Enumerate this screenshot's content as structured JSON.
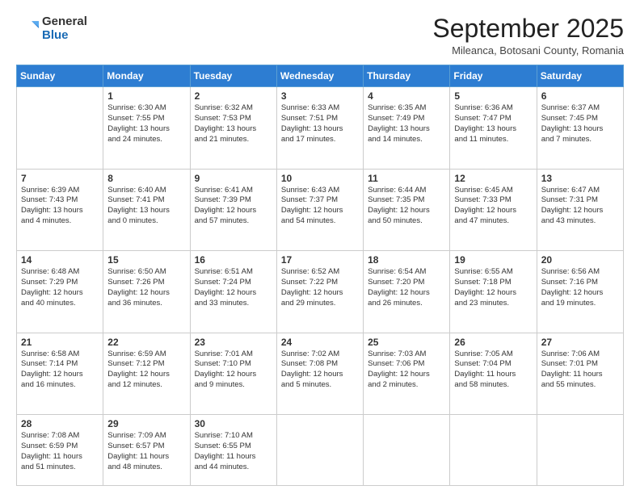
{
  "logo": {
    "general": "General",
    "blue": "Blue"
  },
  "title": "September 2025",
  "location": "Mileanca, Botosani County, Romania",
  "days_of_week": [
    "Sunday",
    "Monday",
    "Tuesday",
    "Wednesday",
    "Thursday",
    "Friday",
    "Saturday"
  ],
  "weeks": [
    [
      {
        "day": "",
        "info": ""
      },
      {
        "day": "1",
        "info": "Sunrise: 6:30 AM\nSunset: 7:55 PM\nDaylight: 13 hours\nand 24 minutes."
      },
      {
        "day": "2",
        "info": "Sunrise: 6:32 AM\nSunset: 7:53 PM\nDaylight: 13 hours\nand 21 minutes."
      },
      {
        "day": "3",
        "info": "Sunrise: 6:33 AM\nSunset: 7:51 PM\nDaylight: 13 hours\nand 17 minutes."
      },
      {
        "day": "4",
        "info": "Sunrise: 6:35 AM\nSunset: 7:49 PM\nDaylight: 13 hours\nand 14 minutes."
      },
      {
        "day": "5",
        "info": "Sunrise: 6:36 AM\nSunset: 7:47 PM\nDaylight: 13 hours\nand 11 minutes."
      },
      {
        "day": "6",
        "info": "Sunrise: 6:37 AM\nSunset: 7:45 PM\nDaylight: 13 hours\nand 7 minutes."
      }
    ],
    [
      {
        "day": "7",
        "info": "Sunrise: 6:39 AM\nSunset: 7:43 PM\nDaylight: 13 hours\nand 4 minutes."
      },
      {
        "day": "8",
        "info": "Sunrise: 6:40 AM\nSunset: 7:41 PM\nDaylight: 13 hours\nand 0 minutes."
      },
      {
        "day": "9",
        "info": "Sunrise: 6:41 AM\nSunset: 7:39 PM\nDaylight: 12 hours\nand 57 minutes."
      },
      {
        "day": "10",
        "info": "Sunrise: 6:43 AM\nSunset: 7:37 PM\nDaylight: 12 hours\nand 54 minutes."
      },
      {
        "day": "11",
        "info": "Sunrise: 6:44 AM\nSunset: 7:35 PM\nDaylight: 12 hours\nand 50 minutes."
      },
      {
        "day": "12",
        "info": "Sunrise: 6:45 AM\nSunset: 7:33 PM\nDaylight: 12 hours\nand 47 minutes."
      },
      {
        "day": "13",
        "info": "Sunrise: 6:47 AM\nSunset: 7:31 PM\nDaylight: 12 hours\nand 43 minutes."
      }
    ],
    [
      {
        "day": "14",
        "info": "Sunrise: 6:48 AM\nSunset: 7:29 PM\nDaylight: 12 hours\nand 40 minutes."
      },
      {
        "day": "15",
        "info": "Sunrise: 6:50 AM\nSunset: 7:26 PM\nDaylight: 12 hours\nand 36 minutes."
      },
      {
        "day": "16",
        "info": "Sunrise: 6:51 AM\nSunset: 7:24 PM\nDaylight: 12 hours\nand 33 minutes."
      },
      {
        "day": "17",
        "info": "Sunrise: 6:52 AM\nSunset: 7:22 PM\nDaylight: 12 hours\nand 29 minutes."
      },
      {
        "day": "18",
        "info": "Sunrise: 6:54 AM\nSunset: 7:20 PM\nDaylight: 12 hours\nand 26 minutes."
      },
      {
        "day": "19",
        "info": "Sunrise: 6:55 AM\nSunset: 7:18 PM\nDaylight: 12 hours\nand 23 minutes."
      },
      {
        "day": "20",
        "info": "Sunrise: 6:56 AM\nSunset: 7:16 PM\nDaylight: 12 hours\nand 19 minutes."
      }
    ],
    [
      {
        "day": "21",
        "info": "Sunrise: 6:58 AM\nSunset: 7:14 PM\nDaylight: 12 hours\nand 16 minutes."
      },
      {
        "day": "22",
        "info": "Sunrise: 6:59 AM\nSunset: 7:12 PM\nDaylight: 12 hours\nand 12 minutes."
      },
      {
        "day": "23",
        "info": "Sunrise: 7:01 AM\nSunset: 7:10 PM\nDaylight: 12 hours\nand 9 minutes."
      },
      {
        "day": "24",
        "info": "Sunrise: 7:02 AM\nSunset: 7:08 PM\nDaylight: 12 hours\nand 5 minutes."
      },
      {
        "day": "25",
        "info": "Sunrise: 7:03 AM\nSunset: 7:06 PM\nDaylight: 12 hours\nand 2 minutes."
      },
      {
        "day": "26",
        "info": "Sunrise: 7:05 AM\nSunset: 7:04 PM\nDaylight: 11 hours\nand 58 minutes."
      },
      {
        "day": "27",
        "info": "Sunrise: 7:06 AM\nSunset: 7:01 PM\nDaylight: 11 hours\nand 55 minutes."
      }
    ],
    [
      {
        "day": "28",
        "info": "Sunrise: 7:08 AM\nSunset: 6:59 PM\nDaylight: 11 hours\nand 51 minutes."
      },
      {
        "day": "29",
        "info": "Sunrise: 7:09 AM\nSunset: 6:57 PM\nDaylight: 11 hours\nand 48 minutes."
      },
      {
        "day": "30",
        "info": "Sunrise: 7:10 AM\nSunset: 6:55 PM\nDaylight: 11 hours\nand 44 minutes."
      },
      {
        "day": "",
        "info": ""
      },
      {
        "day": "",
        "info": ""
      },
      {
        "day": "",
        "info": ""
      },
      {
        "day": "",
        "info": ""
      }
    ]
  ]
}
